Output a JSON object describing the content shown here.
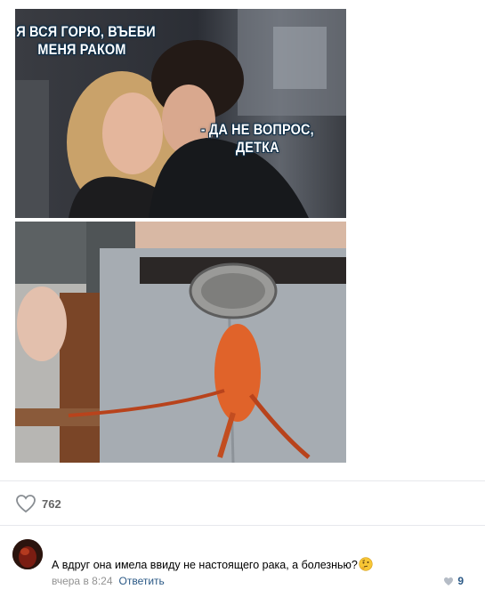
{
  "post": {
    "meme": {
      "top_caption_left": "- Я ВСЯ ГОРЮ, ВЪЕБИ МЕНЯ РАКОМ",
      "top_caption_right": "- ДА НЕ ВОПРОС, ДЕТКА"
    },
    "likes": {
      "count": "762",
      "icon": "heart-outline-icon"
    }
  },
  "comment": {
    "avatar": "user-avatar",
    "text": "А вдруг она имела ввиду не настоящего рака, а болезнью?",
    "emoji": "thinking-face-icon",
    "time": "вчера в 8:24",
    "reply_label": "Ответить",
    "likes": "9"
  },
  "colors": {
    "link": "#2a5885",
    "muted": "#939393",
    "divider": "#e7e8ec"
  }
}
